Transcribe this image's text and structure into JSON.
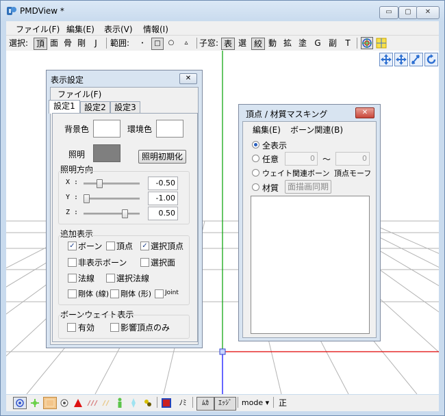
{
  "window": {
    "title": "PMDView *",
    "minimize": "▭",
    "maximize": "▢",
    "close": "✕"
  },
  "menu": [
    "ファイル(F)",
    "編集(E)",
    "表示(V)",
    "情報(I)"
  ],
  "toolbar": {
    "select_label": "選択:",
    "select_items": [
      "頂",
      "面",
      "骨",
      "剛",
      "J"
    ],
    "range_label": "範囲:",
    "range_items": [
      "･",
      "□",
      "○",
      "▵"
    ],
    "child_label": "子窓:",
    "child_items": [
      "表",
      "選",
      "絞",
      "動",
      "拡",
      "塗",
      "G",
      "副",
      "T"
    ]
  },
  "status": {
    "items": [
      "ﾉﾐ",
      "ﾑｶ",
      "ｴｯｼﾞ",
      "mode ▾",
      "正"
    ]
  },
  "display_dialog": {
    "title": "表示設定",
    "menu": "ファイル(F)",
    "tabs": [
      "設定1",
      "設定2",
      "設定3"
    ],
    "bg_color_label": "背景色",
    "env_color_label": "環境色",
    "light_label": "照明",
    "light_reset_button": "照明初期化",
    "light_dir_label": "照明方向",
    "axes": [
      {
        "label": "X :",
        "value": "-0.50",
        "slider": 0.25
      },
      {
        "label": "Y :",
        "value": "-1.00",
        "slider": 0.0
      },
      {
        "label": "Z :",
        "value": "0.50",
        "slider": 0.75
      }
    ],
    "extra_label": "追加表示",
    "checks": [
      {
        "label": "ボーン",
        "checked": true
      },
      {
        "label": "頂点",
        "checked": false
      },
      {
        "label": "選択頂点",
        "checked": true
      },
      {
        "label": "非表示ボーン",
        "checked": false
      },
      {
        "label": "選択面",
        "checked": false
      },
      {
        "label": "法線",
        "checked": false
      },
      {
        "label": "選択法線",
        "checked": false
      },
      {
        "label": "剛体 (線)",
        "checked": false
      },
      {
        "label": "剛体 (形)",
        "checked": false
      },
      {
        "label": "Joint",
        "checked": false
      }
    ],
    "bone_weight_label": "ボーンウェイト表示",
    "weight_checks": [
      {
        "label": "有効",
        "checked": false
      },
      {
        "label": "影響頂点のみ",
        "checked": false
      }
    ]
  },
  "mask_dialog": {
    "title": "頂点 / 材質マスキング",
    "menu": [
      "編集(E)",
      "ボーン関連(B)"
    ],
    "options": {
      "all": "全表示",
      "arbitrary": "任意",
      "from": "0",
      "tilde": "～",
      "to": "0",
      "weight_bone": "ウェイト関連ボーン",
      "vertex_morph": "頂点モーフ",
      "material": "材質",
      "sync_button": "面描画同期"
    }
  },
  "colors": {
    "grid": "#aaaaaa",
    "x_axis": "#e00000",
    "y_axis": "#00a000",
    "z_axis": "#0000ff",
    "light_swatch": "#7f7f7f"
  }
}
